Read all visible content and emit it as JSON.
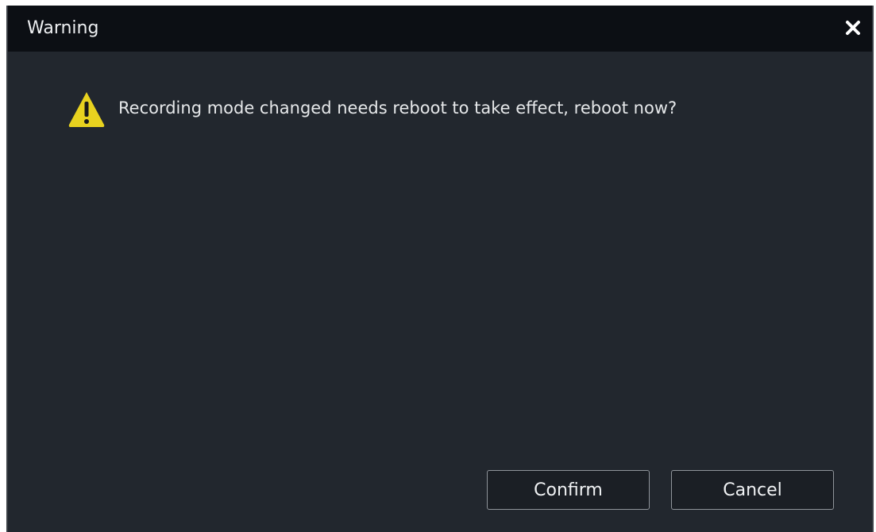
{
  "dialog": {
    "title": "Warning",
    "message": "Recording mode changed needs reboot to take effect, reboot now?",
    "close_icon": "close-icon",
    "warning_icon": "warning-triangle-icon",
    "buttons": {
      "confirm_label": "Confirm",
      "cancel_label": "Cancel"
    }
  },
  "colors": {
    "titlebar_bg": "#0c0f14",
    "body_bg": "#22272e",
    "warning_yellow": "#e8d21f",
    "text": "#e6e8ea",
    "button_border": "#8f949a"
  }
}
